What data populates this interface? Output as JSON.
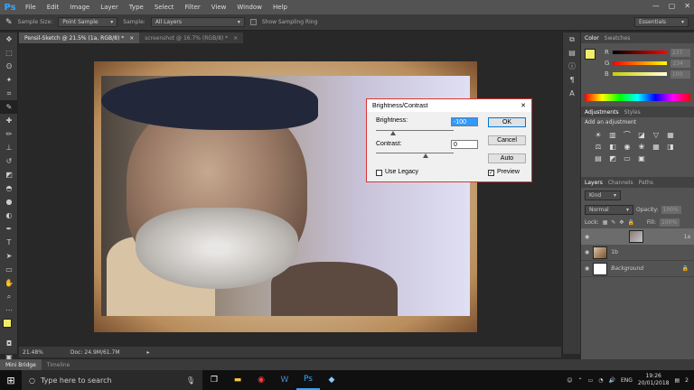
{
  "app": {
    "logo": "Ps"
  },
  "menubar": {
    "items": [
      "File",
      "Edit",
      "Image",
      "Layer",
      "Type",
      "Select",
      "Filter",
      "View",
      "Window",
      "Help"
    ]
  },
  "window_controls": {
    "minimize": "—",
    "maximize": "▢",
    "close": "✕"
  },
  "optionsbar": {
    "sample_size_label": "Sample Size:",
    "sample_size_value": "Point Sample",
    "sample_label": "Sample:",
    "sample_value": "All Layers",
    "show_ring_label": "Show Sampling Ring",
    "workspace": "Essentials"
  },
  "doc_tabs": [
    {
      "label": "Pensil-Sketch @ 21.5% (1a, RGB/8) *",
      "close": "×"
    },
    {
      "label": "screenshot @ 16.7% (RGB/8) *",
      "close": "×"
    }
  ],
  "statusbar": {
    "zoom": "21.48%",
    "doc": "Doc: 24.9M/61.7M"
  },
  "bottom_tabs": [
    "Mini Bridge",
    "Timeline"
  ],
  "panels": {
    "color_tabs": [
      "Color",
      "Swatches"
    ],
    "color_values": {
      "r": "237",
      "g": "234",
      "b": "100"
    },
    "adjust_tabs": [
      "Adjustments",
      "Styles"
    ],
    "adjust_title": "Add an adjustment",
    "layers_tabs": [
      "Layers",
      "Channels",
      "Paths"
    ],
    "kind_label": "Kind",
    "blend_mode": "Normal",
    "opacity_label": "Opacity:",
    "opacity_value": "100%",
    "lock_label": "Lock:",
    "fill_label": "Fill:",
    "fill_value": "100%",
    "layers": [
      {
        "name": "1a"
      },
      {
        "name": "1b"
      },
      {
        "name": "Background"
      }
    ]
  },
  "dialog": {
    "title": "Brightness/Contrast",
    "close": "✕",
    "brightness_label": "Brightness:",
    "brightness_value": "-100",
    "contrast_label": "Contrast:",
    "contrast_value": "0",
    "ok": "OK",
    "cancel": "Cancel",
    "auto": "Auto",
    "use_legacy": "Use Legacy",
    "preview": "Preview",
    "preview_checked": true,
    "legacy_checked": false
  },
  "taskbar": {
    "search_placeholder": "Type here to search",
    "tray_lang": "ENG",
    "time": "19:26",
    "date": "20/01/2018",
    "notifications": "2"
  },
  "colors": {
    "foreground": "#f2ec6a",
    "background": "#ffffff",
    "accent": "#31a8ff"
  }
}
